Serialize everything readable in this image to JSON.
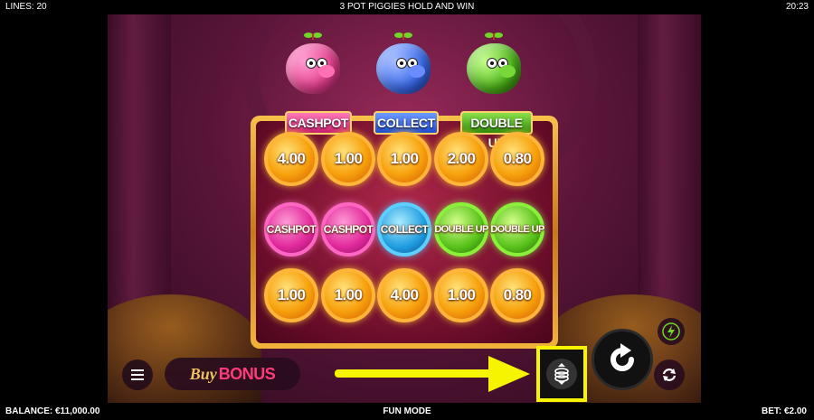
{
  "status_bar": {
    "lines": "LINES: 20",
    "title": "3 POT PIGGIES HOLD AND WIN",
    "time": "20:23"
  },
  "footer": {
    "balance": "BALANCE: €11,000.00",
    "mode": "FUN MODE",
    "bet": "BET: €2.00"
  },
  "pots": [
    {
      "label": "CASHPOT",
      "color": "#e8408f"
    },
    {
      "label": "COLLECT",
      "color": "#3b6df0"
    },
    {
      "label": "DOUBLE UP",
      "color": "#4db71a"
    }
  ],
  "reels": {
    "row1": [
      "4.00",
      "1.00",
      "1.00",
      "2.00",
      "0.80"
    ],
    "row2": [
      "CASHPOT",
      "CASHPOT",
      "COLLECT",
      "DOUBLE UP",
      "DOUBLE UP"
    ],
    "row3": [
      "1.00",
      "1.00",
      "4.00",
      "1.00",
      "0.80"
    ]
  },
  "controls": {
    "buy_prefix": "Buy",
    "buy_bonus": "BONUS"
  },
  "icons": {
    "menu": "menu-icon",
    "stake": "stake-coins-icon",
    "spin": "spin-icon",
    "turbo": "lightning-icon",
    "autoplay": "autoplay-icon"
  },
  "colors": {
    "highlight": "#f7f400",
    "gold": "#f7a10c",
    "turbo": "#6fd62a"
  }
}
